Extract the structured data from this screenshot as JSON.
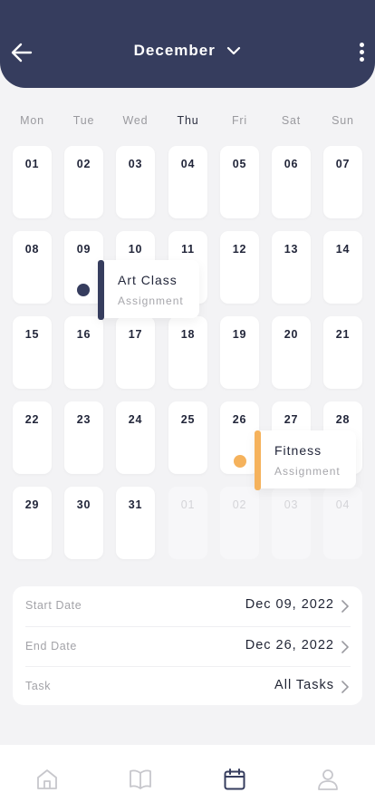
{
  "header": {
    "month": "December",
    "back_icon": "arrow-left-icon",
    "dropdown_icon": "chevron-down-icon",
    "more_icon": "more-vertical-icon",
    "background_color": "#363d5e"
  },
  "weekdays": [
    "Mon",
    "Tue",
    "Wed",
    "Thu",
    "Fri",
    "Sat",
    "Sun"
  ],
  "weeks": [
    [
      {
        "day": "01"
      },
      {
        "day": "02"
      },
      {
        "day": "03"
      },
      {
        "day": "04"
      },
      {
        "day": "05"
      },
      {
        "day": "06"
      },
      {
        "day": "07"
      }
    ],
    [
      {
        "day": "08"
      },
      {
        "day": "09"
      },
      {
        "day": "10"
      },
      {
        "day": "11"
      },
      {
        "day": "12"
      },
      {
        "day": "13"
      },
      {
        "day": "14"
      }
    ],
    [
      {
        "day": "15"
      },
      {
        "day": "16"
      },
      {
        "day": "17"
      },
      {
        "day": "18"
      },
      {
        "day": "19"
      },
      {
        "day": "20"
      },
      {
        "day": "21"
      }
    ],
    [
      {
        "day": "22"
      },
      {
        "day": "23"
      },
      {
        "day": "24"
      },
      {
        "day": "25"
      },
      {
        "day": "26"
      },
      {
        "day": "27"
      },
      {
        "day": "28"
      }
    ],
    [
      {
        "day": "29"
      },
      {
        "day": "30"
      },
      {
        "day": "31"
      },
      {
        "day": "01",
        "muted": true
      },
      {
        "day": "02",
        "muted": true
      },
      {
        "day": "03",
        "muted": true
      },
      {
        "day": "04",
        "muted": true
      }
    ]
  ],
  "events": [
    {
      "title": "Art Class",
      "subtitle": "Assignment",
      "color": "#363d5e"
    },
    {
      "title": "Fitness",
      "subtitle": "Assignment",
      "color": "#f5b25c"
    }
  ],
  "details": [
    {
      "label": "Start Date",
      "value": "Dec 09, 2022"
    },
    {
      "label": "End Date",
      "value": "Dec 26, 2022"
    },
    {
      "label": "Task",
      "value": "All Tasks"
    }
  ],
  "tabbar": {
    "items": [
      {
        "icon": "home-icon",
        "active": false
      },
      {
        "icon": "book-icon",
        "active": false
      },
      {
        "icon": "calendar-icon",
        "active": true
      },
      {
        "icon": "user-icon",
        "active": false
      }
    ],
    "active_color": "#363d5e",
    "inactive_color": "#c7c7cc"
  }
}
